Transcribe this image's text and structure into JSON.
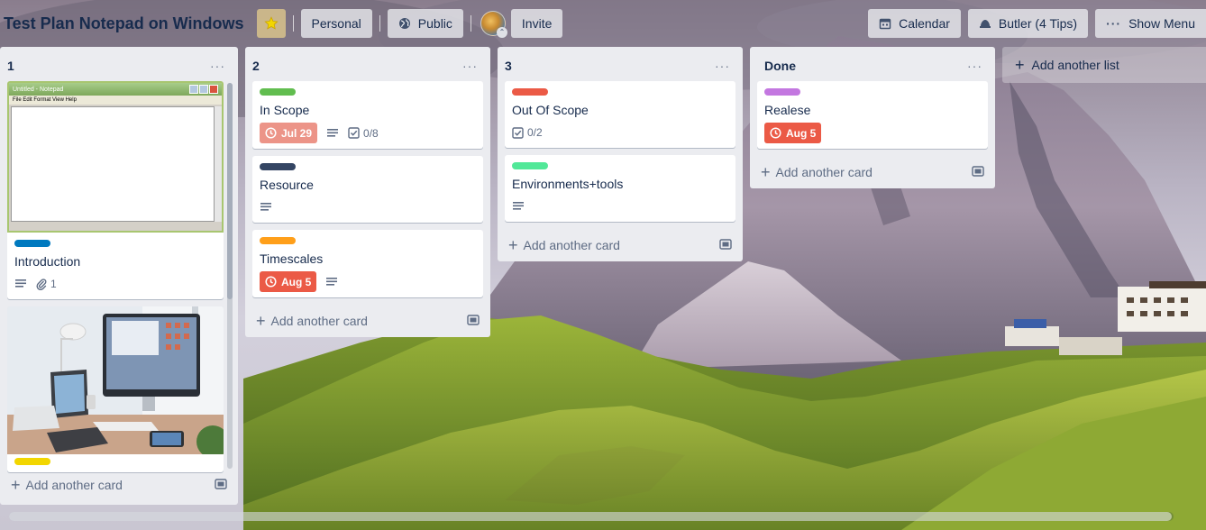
{
  "board": {
    "title": "Test Plan Notepad on Windows",
    "personal_label": "Personal",
    "public_label": "Public",
    "invite_label": "Invite",
    "calendar_label": "Calendar",
    "butler_label": "Butler (4 Tips)",
    "show_menu_label": "Show Menu"
  },
  "lists": [
    {
      "title": "1",
      "cards": [
        {
          "title": "Introduction",
          "label_color": "#0079bf",
          "has_description": true,
          "attachments": "1",
          "image": "notepad"
        },
        {
          "title": "",
          "label_color": "#f2d600",
          "image": "desk"
        }
      ],
      "add_card_label": "Add another card"
    },
    {
      "title": "2",
      "cards": [
        {
          "title": "In Scope",
          "label_color": "#61bd4f",
          "due": "Jul 29",
          "due_style": "pink",
          "has_description": true,
          "checklist": "0/8"
        },
        {
          "title": "Resource",
          "label_color": "#344563",
          "has_description": true
        },
        {
          "title": "Timescales",
          "label_color": "#ff9f1a",
          "due": "Aug 5",
          "due_style": "red",
          "has_description": true
        }
      ],
      "add_card_label": "Add another card"
    },
    {
      "title": "3",
      "cards": [
        {
          "title": "Out Of Scope",
          "label_color": "#eb5a46",
          "checklist": "0/2"
        },
        {
          "title": "Environments+tools",
          "label_color": "#51e898",
          "has_description": true
        }
      ],
      "add_card_label": "Add another card"
    },
    {
      "title": "Done",
      "cards": [
        {
          "title": "Realese",
          "label_color": "#c377e0",
          "due": "Aug 5",
          "due_style": "red"
        }
      ],
      "add_card_label": "Add another card"
    }
  ],
  "add_list_label": "Add another list",
  "notepad_image": {
    "window_title": "Untitled - Notepad",
    "menu": "File   Edit   Format   View   Help"
  },
  "icons": {
    "star": "star-icon",
    "globe": "globe-icon",
    "calendar": "calendar-icon",
    "butler": "butler-icon",
    "menu": "more-icon",
    "description": "description-icon",
    "attachment": "paperclip-icon",
    "checklist": "checklist-icon",
    "clock": "clock-icon",
    "plus": "plus-icon",
    "template": "card-template-icon"
  },
  "colors": {
    "star": "#f2d600",
    "due_red": "#eb5a46",
    "due_pink": "#ec9488",
    "list_bg": "#ebecf0"
  }
}
